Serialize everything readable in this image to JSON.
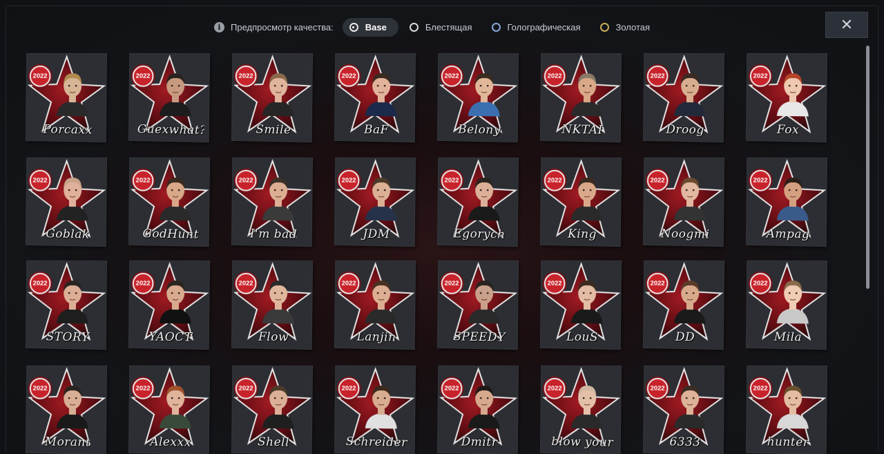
{
  "quality_preview": {
    "label": "Предпросмотр качества:",
    "options": [
      {
        "label": "Base",
        "active": true,
        "ring_color": "#e8e8e8"
      },
      {
        "label": "Блестящая",
        "active": false,
        "ring_color": "#d9d9d9"
      },
      {
        "label": "Голографическая",
        "active": false,
        "ring_color": "#8aa6d8"
      },
      {
        "label": "Золотая",
        "active": false,
        "ring_color": "#c9ad5a"
      }
    ]
  },
  "close_label": "✕",
  "badge_text": "2022",
  "stickers": [
    {
      "signature": "Porcaxx",
      "skin": "#d7b496",
      "hair": "#b08a4e",
      "shirt": "#2a2a2a"
    },
    {
      "signature": "Guexwhat?",
      "skin": "#c79a80",
      "hair": "#2a2420",
      "shirt": "#1d1d1d"
    },
    {
      "signature": "Smile",
      "skin": "#e0b59c",
      "hair": "#8a6a4a",
      "shirt": "#262626"
    },
    {
      "signature": "BaF",
      "skin": "#e2b39a",
      "hair": "#3a2a20",
      "shirt": "#1b2a4a"
    },
    {
      "signature": "Belony",
      "skin": "#e1b79a",
      "hair": "#3a2a20",
      "shirt": "#3b6fb0"
    },
    {
      "signature": "NKTAI",
      "skin": "#d8a888",
      "hair": "#8a7a6a",
      "shirt": "#2a2a2a"
    },
    {
      "signature": "Droog",
      "skin": "#d9ae90",
      "hair": "#3a2a22",
      "shirt": "#222a3a"
    },
    {
      "signature": "Fox",
      "skin": "#efc8b0",
      "hair": "#b5452a",
      "shirt": "#e8e8e8"
    },
    {
      "signature": "Goblak",
      "skin": "#e0b09a",
      "hair": "#c9a38a",
      "shirt": "#222"
    },
    {
      "signature": "GodHunt",
      "skin": "#d8a888",
      "hair": "#3a2a20",
      "shirt": "#2a2a2a"
    },
    {
      "signature": "I'm bad",
      "skin": "#dcae94",
      "hair": "#3a3028",
      "shirt": "#3a3a3a"
    },
    {
      "signature": "JDM",
      "skin": "#dbb095",
      "hair": "#4a3828",
      "shirt": "#26324a"
    },
    {
      "signature": "Egorych",
      "skin": "#dcb098",
      "hair": "#2a2420",
      "shirt": "#1a1a1a"
    },
    {
      "signature": "King",
      "skin": "#d9a88a",
      "hair": "#3a2a20",
      "shirt": "#2a2a2a"
    },
    {
      "signature": "Noogmi",
      "skin": "#e2b8a0",
      "hair": "#6a4a30",
      "shirt": "#333"
    },
    {
      "signature": "Ampag",
      "skin": "#d4a080",
      "hair": "#2a2018",
      "shirt": "#3a5a8a"
    },
    {
      "signature": "STORY",
      "skin": "#dcae96",
      "hair": "#2a2420",
      "shirt": "#1e1e1e"
    },
    {
      "signature": "YAOCT",
      "skin": "#d8aa8e",
      "hair": "#2a2420",
      "shirt": "#111"
    },
    {
      "signature": "Flow",
      "skin": "#e0b69c",
      "hair": "#2a2a2a",
      "shirt": "#3a3a3a"
    },
    {
      "signature": "Lanjin",
      "skin": "#dcae92",
      "hair": "#4a3020",
      "shirt": "#2a2a2a"
    },
    {
      "signature": "SPEEDY",
      "skin": "#c9a08a",
      "hair": "#2a2420",
      "shirt": "#2a2a2a"
    },
    {
      "signature": "LouS",
      "skin": "#e2bca4",
      "hair": "#3a2a20",
      "shirt": "#1a1a1a"
    },
    {
      "signature": "DD",
      "skin": "#d8aa8c",
      "hair": "#5a3a28",
      "shirt": "#1a1a1a"
    },
    {
      "signature": "Mila",
      "skin": "#f0ccb4",
      "hair": "#8a6a4a",
      "shirt": "#c8c8c8"
    },
    {
      "signature": "Morant",
      "skin": "#d8ae94",
      "hair": "#2a2420",
      "shirt": "#1a1a1a"
    },
    {
      "signature": "Alexxx",
      "skin": "#e0b49a",
      "hair": "#a0522d",
      "shirt": "#3a4a3a"
    },
    {
      "signature": "Shell",
      "skin": "#dcb096",
      "hair": "#4a3a2a",
      "shirt": "#1f1f1f"
    },
    {
      "signature": "Schreider",
      "skin": "#d8ac90",
      "hair": "#3a2a1e",
      "shirt": "#e0e0e0"
    },
    {
      "signature": "Dmitr",
      "skin": "#d6a88e",
      "hair": "#1e1a18",
      "shirt": "#1a1a1a"
    },
    {
      "signature": "blow your",
      "skin": "#e4c0a8",
      "hair": "#d0b8a0",
      "shirt": "#2a2a2a"
    },
    {
      "signature": "6333",
      "skin": "#ddb298",
      "hair": "#3a2c22",
      "shirt": "#2a2a2a"
    },
    {
      "signature": "hunter",
      "skin": "#e4bca2",
      "hair": "#6a5030",
      "shirt": "#d8d8d8"
    }
  ]
}
